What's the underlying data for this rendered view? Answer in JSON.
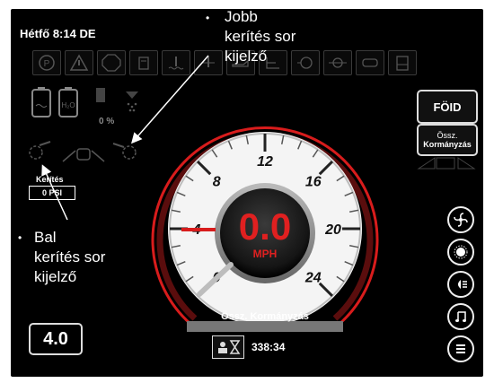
{
  "status": {
    "datetime": "Hétfő 8:14 DE"
  },
  "warning_icons": [
    "parking-brake-icon",
    "warning-triangle-icon",
    "stop-icon",
    "hydraulic-filter-icon",
    "coolant-temp-icon",
    "hydraulic-temp-icon",
    "engine-oil-icon",
    "transmission-icon",
    "air-filter-icon",
    "water-in-fuel-icon",
    "belt-icon",
    "fuel-level-icon"
  ],
  "left_panel": {
    "fuel_pct": "0 %",
    "pressure_label": "Kerítés",
    "pressure_value": "0 PSI"
  },
  "right_buttons": {
    "gear_label": "FÖID",
    "steering_line1": "Össz.",
    "steering_line2": "Kormányzás"
  },
  "gauge": {
    "speed": "0.0",
    "unit": "MPH",
    "mode_label": "Össz. Kormányzás",
    "ticks": [
      "0",
      "4",
      "8",
      "12",
      "16",
      "20",
      "24"
    ]
  },
  "bottom": {
    "version": "4.0",
    "hours": "338:34"
  },
  "annotations": {
    "right": {
      "bullet": "•",
      "line1": "Jobb",
      "line2": "kerítés sor",
      "line3": "kijelző"
    },
    "left": {
      "bullet": "•",
      "line1": "Bal",
      "line2": "kerítés sor",
      "line3": "kijelző"
    }
  },
  "colors": {
    "accent_red": "#e02020",
    "screen_bg": "#000000",
    "gauge_face": "#f4f4f4"
  }
}
